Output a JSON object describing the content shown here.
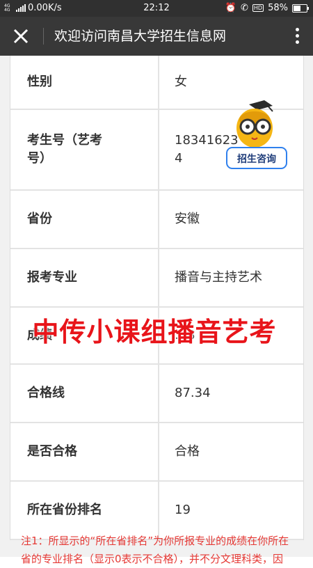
{
  "status_bar": {
    "network": "4G 4G",
    "speed": "0.00K/s",
    "time": "22:12",
    "hd": "HD",
    "battery": "58%",
    "battery_level": 0.58
  },
  "title_bar": {
    "title": "欢迎访问南昌大学招生信息网"
  },
  "rows": [
    {
      "label": "性别",
      "value": "女"
    },
    {
      "label": "考生号（艺考号）",
      "value": "18341623…74"
    },
    {
      "label": "省份",
      "value": "安徽"
    },
    {
      "label": "报考专业",
      "value": "播音与主持艺术"
    },
    {
      "label": "成绩",
      "value": "…8"
    },
    {
      "label": "合格线",
      "value": "87.34"
    },
    {
      "label": "是否合格",
      "value": "合格"
    },
    {
      "label": "所在省份排名",
      "value": "19"
    }
  ],
  "row2_label_lines": [
    "考生号（艺考",
    "号）"
  ],
  "row2_value_lines": [
    "18341623",
    "4"
  ],
  "mascot_button": "招生咨询",
  "banner": "中传小课组播音艺考",
  "note": "注1：所显示的“所在省排名”为你所报专业的成绩在你所在省的专业排名（显示0表示不合格），并不分文理科类，因"
}
